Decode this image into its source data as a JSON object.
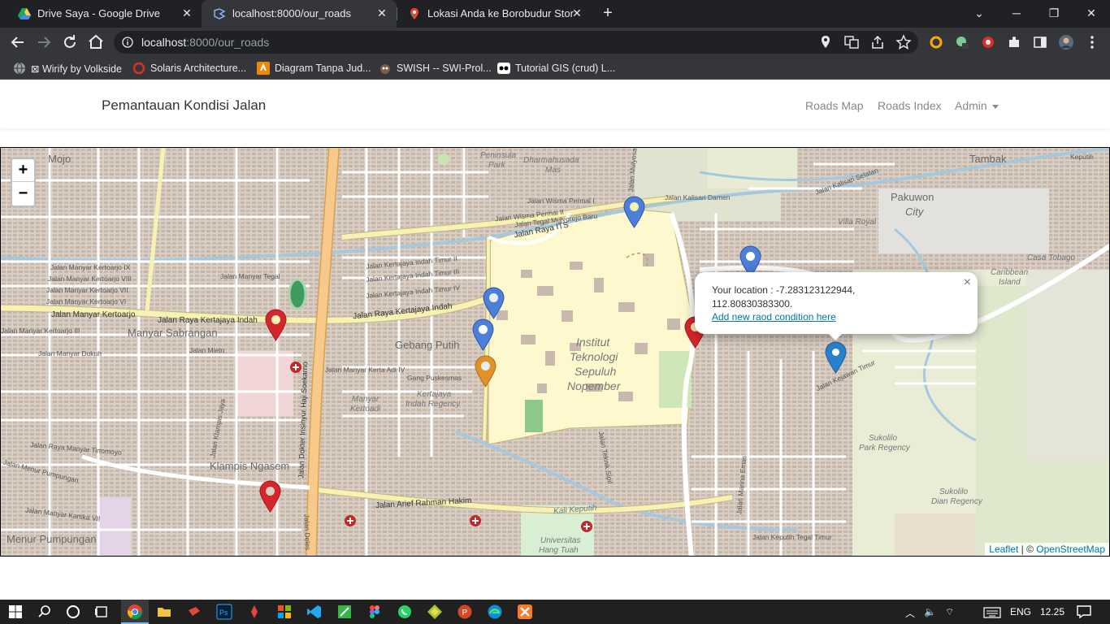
{
  "browser": {
    "tabs": [
      {
        "title": "Drive Saya - Google Drive",
        "icon": "google-drive-icon",
        "active": false
      },
      {
        "title": "localhost:8000/our_roads",
        "icon": "laravel-icon",
        "active": true
      },
      {
        "title": "Lokasi Anda ke Borobudur Store",
        "icon": "google-maps-icon",
        "active": false
      }
    ],
    "url_host": "localhost",
    "url_path": ":8000/our_roads",
    "bookmarks": [
      {
        "label": "⊠ Wirify by Volkside"
      },
      {
        "label": "Solaris Architecture..."
      },
      {
        "label": "Diagram Tanpa Jud..."
      },
      {
        "label": "SWISH -- SWI-Prol..."
      },
      {
        "label": "Tutorial GIS (crud) L..."
      }
    ]
  },
  "navbar": {
    "brand": "Pemantauan Kondisi Jalan",
    "links": [
      "Roads Map",
      "Roads Index",
      "Admin"
    ]
  },
  "map": {
    "zoom_in": "+",
    "zoom_out": "−",
    "labels": {
      "mojo": "Mojo",
      "tambak": "Tambak",
      "pakuwon": "Pakuwon",
      "city": "City",
      "manyar": "Manyar Sabrangan",
      "gebang": "Gebang Putih",
      "institut1": "Institut",
      "institut2": "Teknologi",
      "institut3": "Sepuluh",
      "institut4": "Nopember",
      "klampis": "Klampis Ngasem",
      "menur": "Menur Pumpungan",
      "villa": "Villa Royal",
      "caribbean1": "Caribbean",
      "caribbean2": "Island",
      "tobago": "Casa Tobago",
      "sukolilo1": "Sukolilo",
      "sukolilo2": "Park Regency",
      "sukolilo3": "Sukolilo",
      "sukolilo4": "Dian Regency",
      "peninsula1": "Peninsula",
      "peninsula2": "Park",
      "dharma1": "Dharmahusada",
      "dharma2": "Mas",
      "univ1": "Universitas",
      "univ2": "Hang Tuah",
      "kertajaya1": "Kertajaya",
      "kertajaya2": "Indah Regency",
      "manyarkert1": "Manyar",
      "manyarkert2": "Kertoadi",
      "keputih": "Keputih",
      "st_its": "Jalan Raya ITS",
      "st_kertajaya": "Jalan Raya Kertajaya Indah",
      "st_kertajaya2": "Jalan Raya Kertajaya Indah",
      "st_manyar": "Jalan Manyar Kertoarjo",
      "st_arief": "Jalan Arief Rahman Hakim",
      "st_soekarno": "Jalan Dokter Insinyur Haji Soekarno",
      "st_kalisari": "Jalan Kalisari Damen",
      "st_wisma": "Jalan Wisma Permai I",
      "st_wisma2": "Jalan Wisma Permai II",
      "st_tegal": "Jalan Tegal Mulyorejo Baru",
      "st_kertajayaT2": "Jalan Kertajaya Indah Timur II",
      "st_kertajayaT3": "Jalan Kertajaya Indah Timur III",
      "st_kertajayaT4": "Jalan Kertajaya Indah Timur IV",
      "st_manyartegal": "Jalan Manyar Tegal",
      "st_mk9": "Jalan Manyar Kertoarjo IX",
      "st_mk8": "Jalan Manyar Kertoarjo VIII",
      "st_mk7": "Jalan Manyar Kertoarjo VII",
      "st_mk6": "Jalan Manyar Kertoarjo VI",
      "st_mieto": "Jalan Mieto",
      "st_dukuh": "Jalan Manyar Dukuh",
      "st_mk3": "Jalan Manyar Kertoarjo III",
      "st_mkerta": "Jalan Manyar Kerta Adi IV",
      "st_puskesmas": "Gang Puskesmas",
      "st_tirtomoyo": "Jalan Raya Manyar Tirtomoyo",
      "st_menur": "Jalan Menur Pumpungan",
      "st_kartika": "Jalan Manyar Kartika VII",
      "st_keputih": "Jalan Keputih Tegal Timur",
      "st_kalisari2": "Jalan Kalisari Selatan",
      "st_kejawan": "Jalan Kejawan Timur",
      "st_klampis": "Jalan Klampis Jaya",
      "st_delles": "Jalan Deles",
      "st_teknik": "Jalan Teknik Sipil",
      "st_kali": "Kali Keputih",
      "st_mulyosari": "Jalan Mulyosari",
      "st_marina": "Jalan Marina Emas"
    },
    "popup": {
      "text": "Your location : -7.283123122944, 112.80830383300.",
      "link": "Add new raod condition here",
      "close": "×"
    },
    "attribution_leaflet": "Leaflet",
    "attribution_sep": " | © ",
    "attribution_osm": "OpenStreetMap",
    "marker_colors": {
      "red": "#d6262c",
      "blue": "#4d7fd9",
      "orange": "#e0912a",
      "popup_blue": "#2a81cb"
    }
  },
  "taskbar": {
    "lang": "ENG",
    "time": "12.25"
  }
}
